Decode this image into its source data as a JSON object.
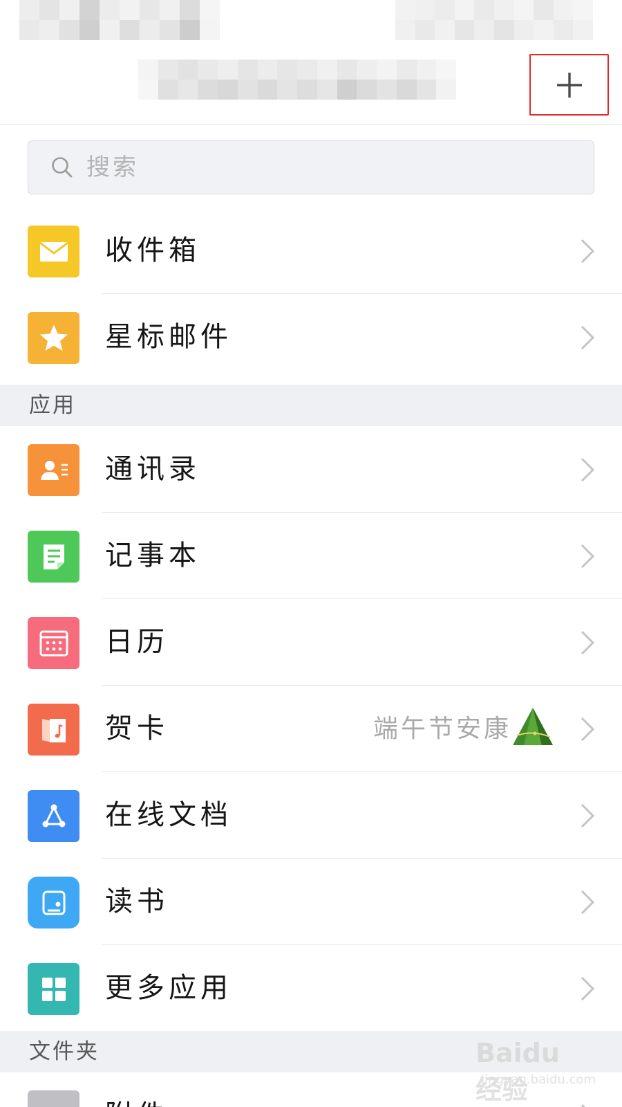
{
  "header": {
    "add_icon": "plus-icon"
  },
  "search": {
    "placeholder": "搜索",
    "icon": "search-icon"
  },
  "mail_items": [
    {
      "label": "收件箱",
      "icon": "envelope-icon",
      "color": "#f5c827"
    },
    {
      "label": "星标邮件",
      "icon": "star-icon",
      "color": "#f6b234"
    }
  ],
  "apps_section": {
    "title": "应用"
  },
  "app_items": [
    {
      "label": "通讯录",
      "icon": "contact-card-icon",
      "color": "#f6923a"
    },
    {
      "label": "记事本",
      "icon": "note-icon",
      "color": "#4fc85a"
    },
    {
      "label": "日历",
      "icon": "calendar-icon",
      "color": "#f76c7c"
    },
    {
      "label": "贺卡",
      "icon": "greeting-card-icon",
      "color": "#f26b4c",
      "extra": "端午节安康",
      "extra_icon": "zongzi-icon"
    },
    {
      "label": "在线文档",
      "icon": "share-node-icon",
      "color": "#3f8cf2"
    },
    {
      "label": "读书",
      "icon": "book-icon",
      "color": "#3fa8f5"
    },
    {
      "label": "更多应用",
      "icon": "grid-icon",
      "color": "#34b7b0"
    }
  ],
  "folders_section": {
    "title": "文件夹"
  },
  "folder_items": [
    {
      "label": "附件",
      "icon": "folder-icon",
      "color": "#bfbfc4"
    }
  ],
  "watermark": {
    "brand": "Baidu 经验",
    "url": "jingyan.baidu.com"
  },
  "colors": {
    "highlight": "#e02b2b",
    "section_bg": "#eff0f3",
    "chevron": "#c4c4c4"
  }
}
